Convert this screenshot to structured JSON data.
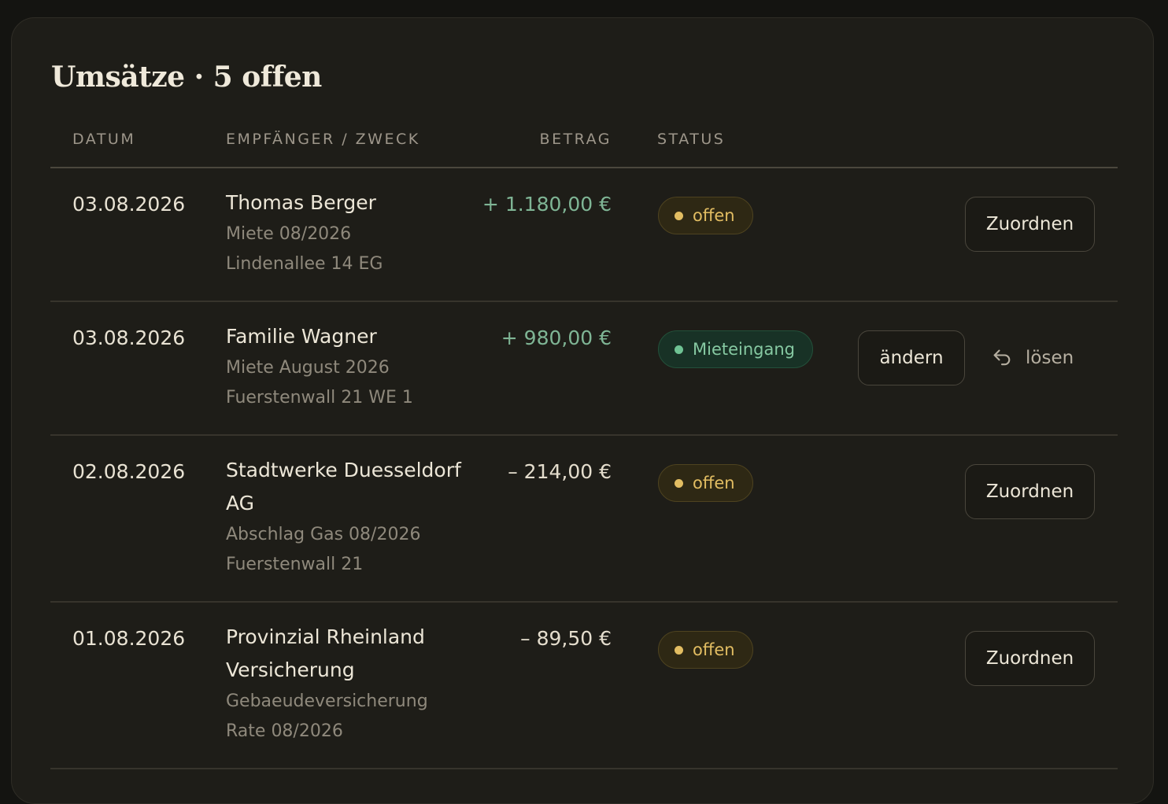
{
  "header": {
    "title": "Umsätze · 5 offen"
  },
  "columns": {
    "date": "DATUM",
    "recipient": "EMPFÄNGER / ZWECK",
    "amount": "BETRAG",
    "status": "STATUS"
  },
  "transactions": [
    {
      "date": "03.08.2026",
      "name": "Thomas Berger",
      "purpose": "Miete 08/2026",
      "property": "Lindenallee 14 EG",
      "amount": "+ 1.180,00 €",
      "status": "offen",
      "action": "Zuordnen"
    },
    {
      "date": "03.08.2026",
      "name": "Familie Wagner",
      "purpose": "Miete August 2026",
      "property": "Fuerstenwall 21 WE 1",
      "amount": "+ 980,00 €",
      "status": "Mieteingang",
      "edit_label": "ändern",
      "release_label": "lösen"
    },
    {
      "date": "02.08.2026",
      "name": "Stadtwerke Duesseldorf AG",
      "purpose": "Abschlag Gas 08/2026",
      "property": "Fuerstenwall 21",
      "amount": "– 214,00 €",
      "status": "offen",
      "action": "Zuordnen"
    },
    {
      "date": "01.08.2026",
      "name": "Provinzial Rheinland Versicherung",
      "purpose": "Gebaeudeversicherung",
      "property": "Rate 08/2026",
      "amount": "– 89,50 €",
      "status": "offen",
      "action": "Zuordnen"
    }
  ],
  "colors": {
    "background": "#1e1d18",
    "positive_amount": "#7fb595",
    "open_status": "#e2bd62",
    "income_status": "#86c9a2"
  },
  "icons": {
    "release": "undo-arrow-icon",
    "status_dot": "dot-icon"
  }
}
